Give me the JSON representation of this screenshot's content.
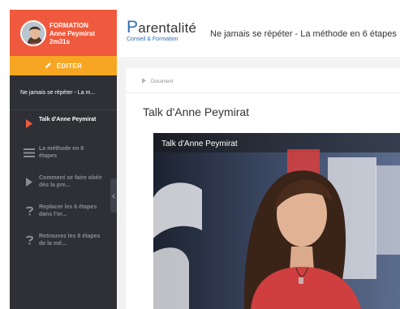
{
  "sidebar": {
    "header": {
      "label": "FORMATION",
      "name": "Anne Peymirat",
      "duration": "2m31s"
    },
    "edit_label": "ÉDITER",
    "course_title": "Ne jamais se répéter - La m...",
    "items": [
      {
        "label": "Talk d'Anne Peymirat",
        "icon": "play-icon",
        "active": true
      },
      {
        "label": "La méthode en 6 étapes",
        "icon": "text-lines-icon",
        "active": false
      },
      {
        "label": "Comment se faire obéir dès la pre...",
        "icon": "play-icon",
        "active": false
      },
      {
        "label": "Replacer les 6 étapes dans l'or...",
        "icon": "question-icon",
        "active": false
      },
      {
        "label": "Retrouvez les 6 étapes de la mé...",
        "icon": "question-icon",
        "active": false
      }
    ]
  },
  "topbar": {
    "logo_main": "arentalité",
    "logo_initial": "P",
    "logo_sub": "Conseil & Formation",
    "heading": "Ne jamais se répéter - La méthode en 6 étapes"
  },
  "content": {
    "breadcrumb": "Document",
    "title": "Talk d'Anne Peymirat",
    "video_title": "Talk d'Anne Peymirat"
  },
  "colors": {
    "sidebar_bg": "#2e3036",
    "header_orange": "#ef5a3e",
    "edit_yellow": "#f6a623",
    "active_icon": "#ef5a3e",
    "brand_blue": "#2c6fb4"
  }
}
